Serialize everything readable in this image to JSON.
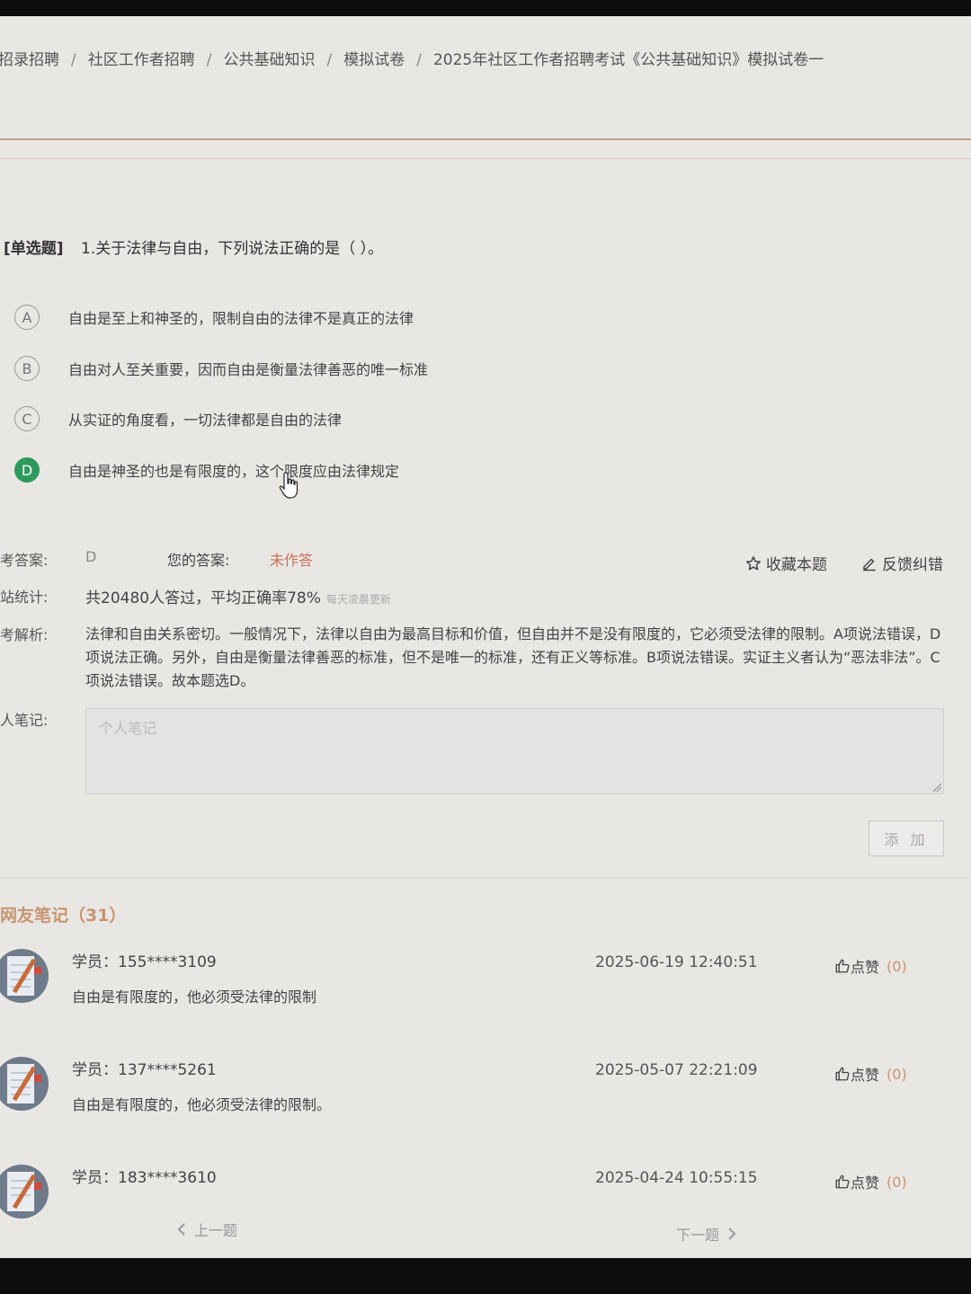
{
  "breadcrumb": [
    "招录招聘",
    "社区工作者招聘",
    "公共基础知识",
    "模拟试卷",
    "2025年社区工作者招聘考试《公共基础知识》模拟试卷一"
  ],
  "breadcrumb_sep": "/",
  "question": {
    "type_label": "[单选题]",
    "text": "1.关于法律与自由，下列说法正确的是（  ）。",
    "options": [
      {
        "letter": "A",
        "text": "自由是至上和神圣的，限制自由的法律不是真正的法律"
      },
      {
        "letter": "B",
        "text": "自由对人至关重要，因而自由是衡量法律善恶的唯一标准"
      },
      {
        "letter": "C",
        "text": "从实证的角度看，一切法律都是自由的法律"
      },
      {
        "letter": "D",
        "text": "自由是神圣的也是有限度的，这个限度应由法律规定"
      }
    ]
  },
  "answer": {
    "ref_label": "考答案:",
    "ref_value": "D",
    "your_label": "您的答案:",
    "your_value": "未作答",
    "favorite": "收藏本题",
    "feedback": "反馈纠错"
  },
  "stats": {
    "label": "站统计:",
    "text": "共20480人答过，平均正确率78%",
    "note": "每天凌晨更新"
  },
  "analysis": {
    "label": "考解析:",
    "text": "法律和自由关系密切。一般情况下，法律以自由为最高目标和价值，但自由并不是没有限度的，它必须受法律的限制。A项说法错误，D项说法正确。另外，自由是衡量法律善恶的标准，但不是唯一的标准，还有正义等标准。B项说法错误。实证主义者认为“恶法非法”。C项说法错误。故本题选D。"
  },
  "personal_note": {
    "label": "人笔记:",
    "placeholder": "个人笔记",
    "add_button": "添 加"
  },
  "netizen_notes": {
    "title": "网友笔记（31）",
    "like_label": "点赞",
    "items": [
      {
        "user": "学员：155****3109",
        "time": "2025-06-19 12:40:51",
        "likes": "(0)",
        "content": "自由是有限度的，他必须受法律的限制"
      },
      {
        "user": "学员：137****5261",
        "time": "2025-05-07 22:21:09",
        "likes": "(0)",
        "content": "自由是有限度的，他必须受法律的限制。"
      },
      {
        "user": "学员：183****3610",
        "time": "2025-04-24 10:55:15",
        "likes": "(0)",
        "content": ""
      }
    ]
  },
  "pager": {
    "prev": "上一题",
    "next": "下一题"
  },
  "colors": {
    "correct": "#2e9b5c",
    "accent": "#c9946f",
    "unanswered": "#cc6e5a"
  }
}
